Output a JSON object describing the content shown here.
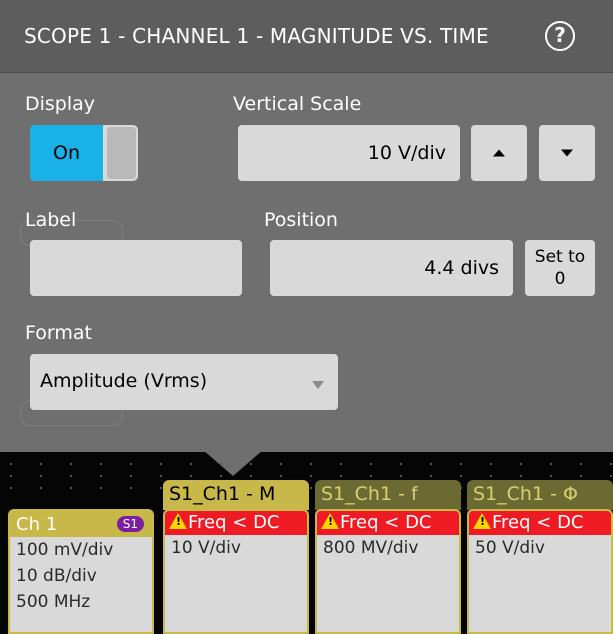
{
  "panel": {
    "title": "SCOPE 1 - CHANNEL 1 - MAGNITUDE VS. TIME",
    "help_icon": "question-circle-icon",
    "display": {
      "label": "Display",
      "state": "On"
    },
    "vertical_scale": {
      "label": "Vertical Scale",
      "value": "10 V/div"
    },
    "label_field": {
      "label": "Label",
      "value": ""
    },
    "position": {
      "label": "Position",
      "value": "4.4 divs",
      "set_button": "Set to 0"
    },
    "format": {
      "label": "Format",
      "selected": "Amplitude (Vrms)"
    }
  },
  "badges": {
    "ch1": {
      "name": "Ch 1",
      "tag": "S1",
      "lines": [
        "100 mV/div",
        "10 dB/div",
        "500 MHz"
      ]
    },
    "math": [
      {
        "tab": "S1_Ch1 - M",
        "warning": "Freq < DC",
        "scale": "10 V/div",
        "active": true
      },
      {
        "tab": "S1_Ch1 - f",
        "warning": "Freq < DC",
        "scale": "800 MV/div",
        "active": false
      },
      {
        "tab": "S1_Ch1 - Φ",
        "warning": "Freq < DC",
        "scale": "50 V/div",
        "active": false
      }
    ]
  },
  "colors": {
    "accent": "#1ab1e8",
    "math_badge": "#c8b84a",
    "warning": "#ef1b24",
    "ch1_tag": "#7b1f9e"
  }
}
